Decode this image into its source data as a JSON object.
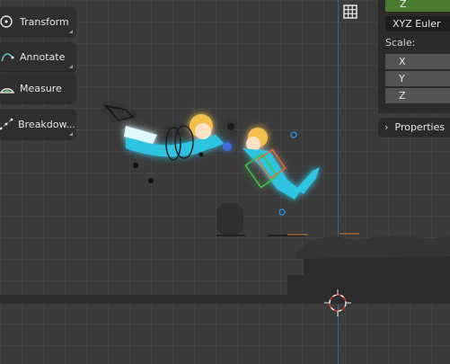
{
  "toolbar": {
    "tools": [
      {
        "name": "transform",
        "label": "Transform",
        "icon": "transform-icon"
      },
      {
        "name": "annotate",
        "label": "Annotate",
        "icon": "annotate-icon"
      },
      {
        "name": "measure",
        "label": "Measure",
        "icon": "measure-icon"
      },
      {
        "name": "breakdown",
        "label": "Breakdow...",
        "icon": "breakdown-icon"
      }
    ]
  },
  "sidebar": {
    "rotation_z": "Z",
    "rotation_mode": "XYZ Euler",
    "scale_label": "Scale:",
    "scale_x": "X",
    "scale_y": "Y",
    "scale_z": "Z",
    "properties_label": "Properties"
  },
  "colors": {
    "accent_green": "#4a7a2f",
    "axis_blue": "#3e6ea8",
    "character_cyan": "#2ec4e0",
    "character_hair": "#f2c14e"
  }
}
